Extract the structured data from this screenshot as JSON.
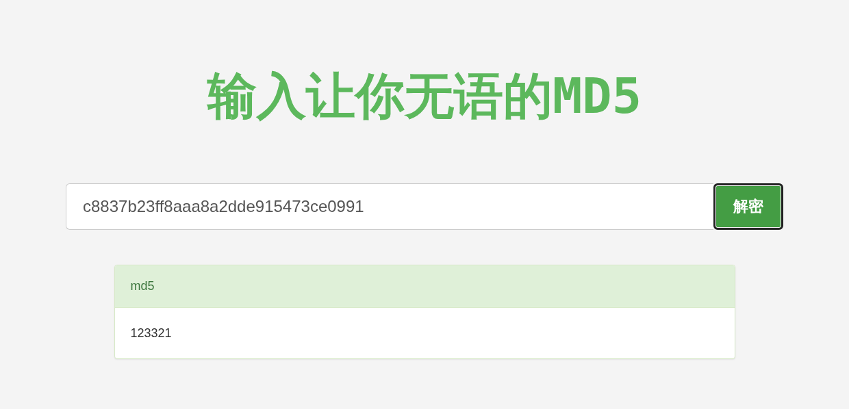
{
  "title": "输入让你无语的MD5",
  "search": {
    "value": "c8837b23ff8aaa8a2dde915473ce0991",
    "button": "解密"
  },
  "result": {
    "heading": "md5",
    "body": "123321"
  }
}
